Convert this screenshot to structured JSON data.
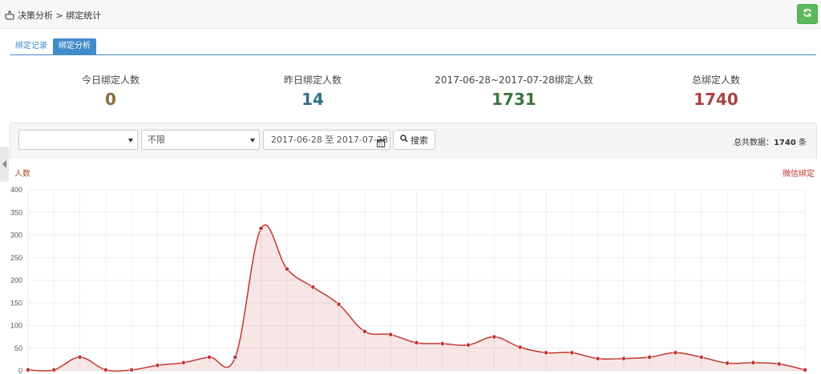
{
  "header": {
    "breadcrumb": "决策分析 > 绑定统计"
  },
  "tabs": [
    {
      "label": "绑定记录",
      "active": false
    },
    {
      "label": "绑定分析",
      "active": true
    }
  ],
  "stats": [
    {
      "label": "今日绑定人数",
      "value": "0",
      "color": "#8a6d3b"
    },
    {
      "label": "昨日绑定人数",
      "value": "14",
      "color": "#31708f"
    },
    {
      "label": "2017-06-28~2017-07-28绑定人数",
      "value": "1731",
      "color": "#3c763d"
    },
    {
      "label": "总绑定人数",
      "value": "1740",
      "color": "#a94442"
    }
  ],
  "filters": {
    "select1_value": "",
    "select2_value": "不限",
    "date_range": "2017-06-28 至 2017-07-28",
    "search_label": "搜索",
    "total_label": "总共数据：",
    "total_value": "1740",
    "total_unit": " 条"
  },
  "chart_data": {
    "type": "area",
    "ylabel": "人数",
    "legend": "微信绑定",
    "legend_position": "top-right",
    "ylim": [
      0,
      400
    ],
    "yticks": [
      0,
      50,
      100,
      150,
      200,
      250,
      300,
      350,
      400
    ],
    "grid": true,
    "color": "#c23531",
    "series": [
      {
        "name": "微信绑定",
        "values": [
          2,
          2,
          30,
          2,
          2,
          12,
          18,
          30,
          30,
          315,
          225,
          185,
          147,
          87,
          80,
          62,
          60,
          57,
          75,
          52,
          40,
          40,
          27,
          27,
          30,
          40,
          30,
          17,
          18,
          15,
          2
        ]
      }
    ]
  }
}
